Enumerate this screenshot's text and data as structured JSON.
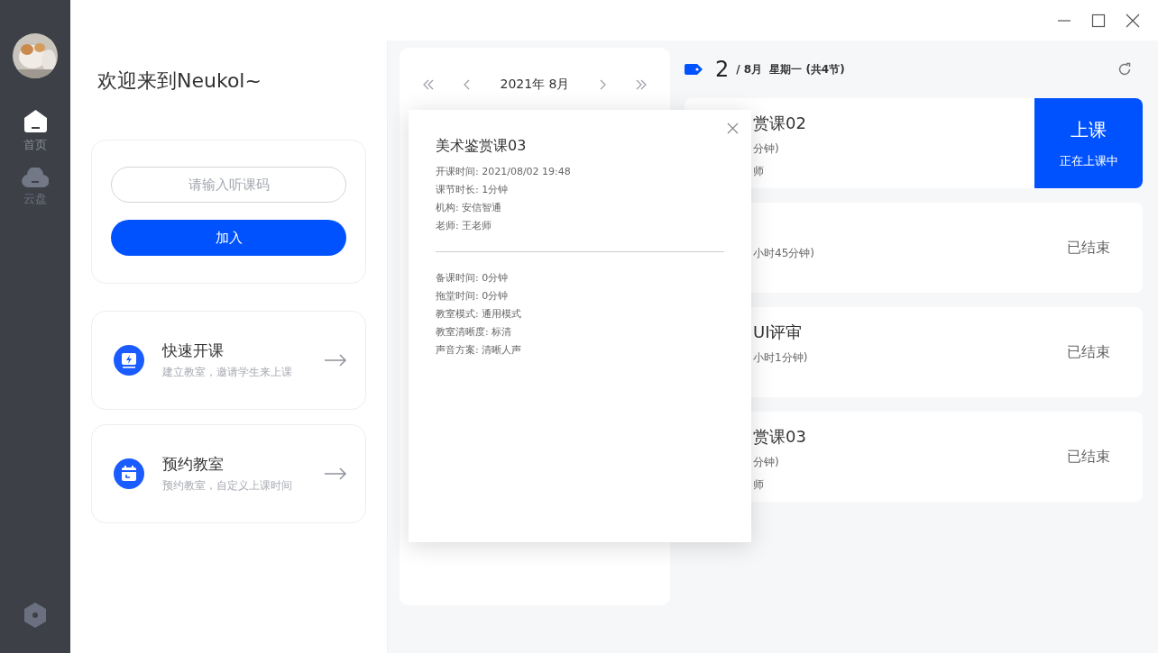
{
  "sidebar": {
    "items": [
      {
        "label": "首页",
        "selected": true,
        "kind": "home"
      },
      {
        "label": "云盘",
        "selected": false,
        "kind": "cloud"
      }
    ]
  },
  "welcome": "欢迎来到Neukol~",
  "join": {
    "placeholder": "请输入听课码",
    "button": "加入"
  },
  "actions": [
    {
      "kind": "quick",
      "title": "快速开课",
      "subtitle": "建立教室，邀请学生来上课"
    },
    {
      "kind": "book",
      "title": "预约教室",
      "subtitle": "预约教室，自定义上课时间"
    }
  ],
  "calendar": {
    "month": "2021年 8月"
  },
  "day": {
    "date": "2",
    "month": "/ 8月",
    "weekday": "星期一 (共4节)"
  },
  "lessons": [
    {
      "title": "赏课02",
      "details": [
        "分钟)",
        "师"
      ],
      "kind": "live",
      "status": "上课",
      "note": "正在上课中"
    },
    {
      "details": [
        "小时45分钟)"
      ],
      "kind": "ended",
      "status": "已结束"
    },
    {
      "title": "UI评审",
      "details": [
        "小时1分钟)"
      ],
      "kind": "ended",
      "status": "已结束"
    },
    {
      "title": "赏课03",
      "details": [
        "分钟)",
        "师"
      ],
      "kind": "ended",
      "status": "已结束"
    }
  ],
  "popup": {
    "title": "美术鉴赏课03",
    "info": [
      "开课时间: 2021/08/02 19:48",
      "课节时长: 1分钟",
      "机构: 安信智通",
      "老师: 王老师"
    ],
    "settings": [
      "备课时间: 0分钟",
      "拖堂时间: 0分钟",
      "教室模式: 通用模式",
      "教室清晰度: 标清",
      "声音方案: 清晰人声"
    ]
  }
}
